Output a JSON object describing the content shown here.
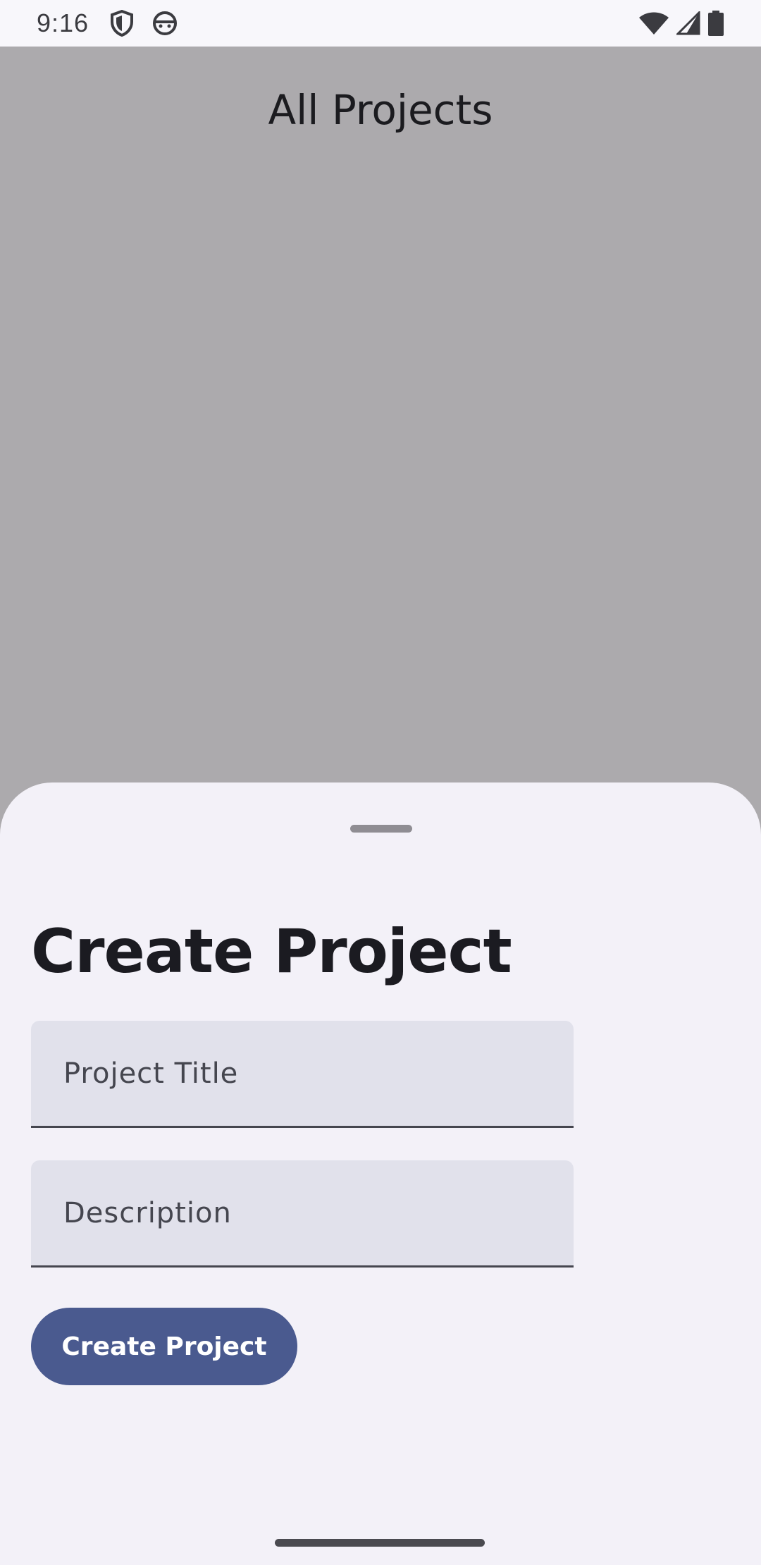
{
  "status_bar": {
    "time": "9:16",
    "icons_left": [
      "shield-icon",
      "android-face-icon"
    ],
    "icons_right": [
      "wifi-icon",
      "cell-signal-icon",
      "battery-icon"
    ]
  },
  "background_page": {
    "title": "All Projects"
  },
  "sheet": {
    "title": "Create Project",
    "fields": {
      "title_placeholder": "Project Title",
      "title_value": "",
      "description_placeholder": "Description",
      "description_value": ""
    },
    "submit_label": "Create Project"
  },
  "colors": {
    "scrim": "#acaaad",
    "sheet_background": "#f3f1f8",
    "field_background": "#e1e1eb",
    "primary_button": "#4a5a8f"
  }
}
